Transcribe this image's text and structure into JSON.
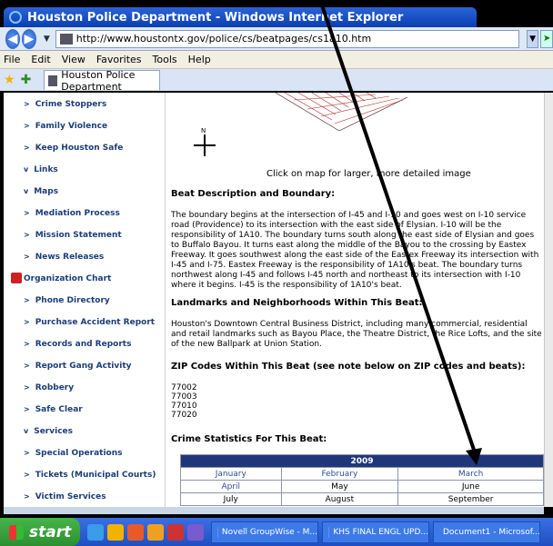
{
  "window": {
    "title": "Houston Police Department - Windows Internet Explorer"
  },
  "address": {
    "url": "http://www.houstontx.gov/police/cs/beatpages/cs1a10.htm"
  },
  "menu": [
    "File",
    "Edit",
    "View",
    "Favorites",
    "Tools",
    "Help"
  ],
  "tab": {
    "label": "Houston Police Department"
  },
  "sidebar": {
    "items": [
      {
        "label": "Crime Stoppers",
        "marker": ">"
      },
      {
        "label": "Family Violence",
        "marker": ">"
      },
      {
        "label": "Keep Houston Safe",
        "marker": ">"
      },
      {
        "label": "Links",
        "marker": "v"
      },
      {
        "label": "Maps",
        "marker": "v"
      },
      {
        "label": "Mediation Process",
        "marker": ">"
      },
      {
        "label": "Mission Statement",
        "marker": ">"
      },
      {
        "label": "News Releases",
        "marker": ">"
      },
      {
        "label": "Organization Chart",
        "marker": "pdf"
      },
      {
        "label": "Phone Directory",
        "marker": ">"
      },
      {
        "label": "Purchase Accident Report",
        "marker": ">"
      },
      {
        "label": "Records and Reports",
        "marker": ">"
      },
      {
        "label": "Report Gang Activity",
        "marker": ">"
      },
      {
        "label": "Robbery",
        "marker": ">"
      },
      {
        "label": "Safe Clear",
        "marker": ">"
      },
      {
        "label": "Services",
        "marker": "v"
      },
      {
        "label": "Special Operations",
        "marker": ">"
      },
      {
        "label": "Tickets (Municipal Courts)",
        "marker": ">"
      },
      {
        "label": "Victim Services",
        "marker": ">"
      }
    ]
  },
  "main": {
    "compass_n": "N",
    "map_caption": "Click on map for larger, more detailed image",
    "beat_heading": "Beat Description and Boundary:",
    "beat_text": "The boundary begins at the intersection of I-45 and I-10 and goes west on I-10 service road (Providence) to its intersection with the east side of Elysian. I-10 will be the responsibility of 1A10. The boundary turns south along the east side of Elysian and goes to Buffalo Bayou. It turns east along the middle of the Bayou to the crossing by Eastex Freeway. It goes southwest along the east side of the Eastex Freeway its intersection with I-45 and I-75. Eastex Freeway is the responsibility of 1A10's beat. The boundary turns northwest along I-45 and follows I-45 north and northeast to its intersection with I-10 where it begins. I-45 is the responsibility of 1A10's beat.",
    "landmarks_heading": "Landmarks and Neighborhoods Within This Beat:",
    "landmarks_text": "Houston's Downtown Central Business District, including many commercial, residential and retail landmarks such as Bayou Place, the Theatre District, the Rice Lofts, and the site of the new Ballpark at Union Station.",
    "zip_heading": "ZIP Codes Within This Beat (see note below on ZIP codes and beats):",
    "zips": [
      "77002",
      "77003",
      "77010",
      "77020"
    ],
    "crime_heading": "Crime Statistics For This Beat:",
    "stats": {
      "year": "2009",
      "rows": [
        [
          "January",
          "February",
          "March"
        ],
        [
          "April",
          "May",
          "June"
        ],
        [
          "July",
          "August",
          "September"
        ]
      ]
    }
  },
  "taskbar": {
    "start_label": "start",
    "tasks": [
      "Novell GroupWise - M...",
      "KHS FINAL ENGL UPD...",
      "Document1 - Microsof..."
    ]
  },
  "colors": {
    "title_bar": "#0b3fb0",
    "sidebar_link": "#1b3d7a",
    "table_header": "#1f3779",
    "start_button": "#2d8f31"
  }
}
